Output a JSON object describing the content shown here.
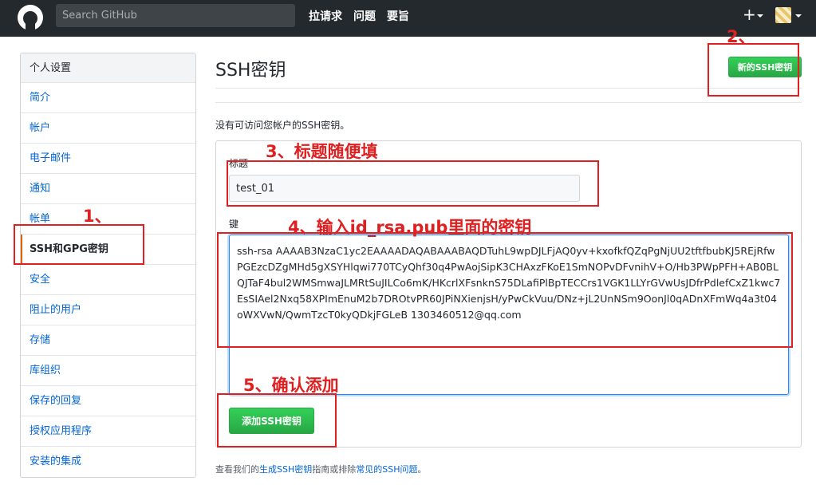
{
  "header": {
    "search_placeholder": "Search GitHub",
    "nav": [
      "拉请求",
      "问题",
      "要旨"
    ],
    "plus_symbol": "+"
  },
  "sidebar": {
    "heading": "个人设置",
    "items": [
      {
        "label": "简介"
      },
      {
        "label": "帐户"
      },
      {
        "label": "电子邮件"
      },
      {
        "label": "通知"
      },
      {
        "label": "帐单"
      },
      {
        "label": "SSH和GPG密钥",
        "active": true
      },
      {
        "label": "安全"
      },
      {
        "label": "阻止的用户"
      },
      {
        "label": "存储"
      },
      {
        "label": "库组织"
      },
      {
        "label": "保存的回复"
      },
      {
        "label": "授权应用程序"
      },
      {
        "label": "安装的集成"
      }
    ]
  },
  "main": {
    "title": "SSH密钥",
    "new_key_button": "新的SSH密钥",
    "no_keys_text": "没有可访问您帐户的SSH密钥。",
    "form": {
      "title_label": "标题",
      "title_value": "test_01",
      "key_label": "键",
      "key_value": "ssh-rsa AAAAB3NzaC1yc2EAAAADAQABAAABAQDTuhL9wpDJLFjAQ0yv+kxofkfQZqPgNjUU2tftfbubKJ5REjRfwPGEzcDZgMHd5gXSYHlqwi770TCyQhf30q4PwAojSipK3CHAxzFKoE1SmNOPvDFvnihV+O/Hb3PWpPFH+AB0BLQJTaF4bul2WMSmwaJLMRtSuJILCo6mK/HKcrlXFsnknS75DLafiPlBpTECCrs1VGK1LLYrGVwUsJDfrPdlefCxZ1kwc7EsSIAel2Nxq58XPImEnuM2b7DROtvPR60JPiNXienjsH/yPwCkVuu/DNz+jL2UnNSm9OonJl0qADnXFmWq4a3t04oWXVwN/QwmTzcT0kyQDkjFGLeB 1303460512@qq.com",
      "add_button": "添加SSH密钥"
    },
    "footer": {
      "prefix": "查看我们的",
      "link1": "生成SSH密钥",
      "middle": "指南或排除",
      "link2": "常见的SSH问题",
      "suffix": "。"
    }
  },
  "annotations": {
    "step1": "1、",
    "step2": "2、",
    "step3": "3、标题随便填",
    "step4": "4、输入id_rsa.pub里面的密钥",
    "step5": "5、确认添加",
    "color": "#e02020"
  }
}
